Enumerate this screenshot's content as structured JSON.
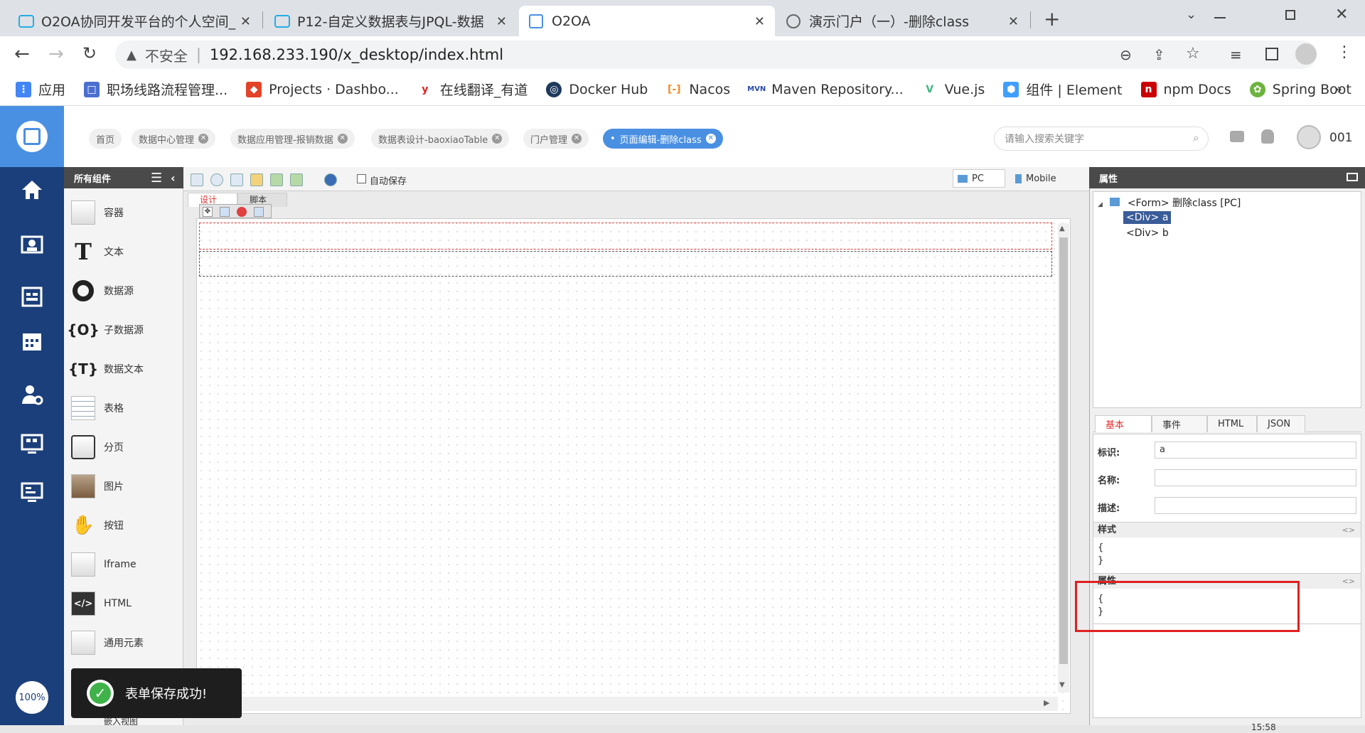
{
  "browser": {
    "tabs": [
      {
        "title": "O2OA协同开发平台的个人空间_"
      },
      {
        "title": "P12-自定义数据表与JPQL-数据"
      },
      {
        "title": "O2OA"
      },
      {
        "title": "演示门户（一）-删除class"
      }
    ],
    "new_tab_label": "+",
    "security_label": "不安全",
    "url": "192.168.233.190/x_desktop/index.html",
    "bookmarks": [
      {
        "label": "应用"
      },
      {
        "label": "职场线路流程管理..."
      },
      {
        "label": "Projects · Dashbo..."
      },
      {
        "label": "在线翻译_有道"
      },
      {
        "label": "Docker Hub"
      },
      {
        "label": "Nacos"
      },
      {
        "label": "Maven Repository..."
      },
      {
        "label": "Vue.js"
      },
      {
        "label": "组件 | Element"
      },
      {
        "label": "npm Docs"
      },
      {
        "label": "Spring Boot"
      }
    ],
    "more_label": "»"
  },
  "header": {
    "breadcrumbs": [
      {
        "label": "首页"
      },
      {
        "label": "数据中心管理"
      },
      {
        "label": "数据应用管理-报销数据"
      },
      {
        "label": "数据表设计-baoxiaoTable"
      },
      {
        "label": "门户管理"
      },
      {
        "label": "页面编辑-删除class"
      }
    ],
    "search_placeholder": "请输入搜索关键字",
    "user": "001"
  },
  "leftnav": {
    "zoom": "100%"
  },
  "components": {
    "title": "所有组件",
    "items": [
      {
        "label": "容器"
      },
      {
        "label": "文本"
      },
      {
        "label": "数据源"
      },
      {
        "label": "子数据源"
      },
      {
        "label": "数据文本"
      },
      {
        "label": "表格"
      },
      {
        "label": "分页"
      },
      {
        "label": "图片"
      },
      {
        "label": "按钮"
      },
      {
        "label": "Iframe"
      },
      {
        "label": "HTML"
      },
      {
        "label": "通用元素"
      }
    ],
    "partial_label": "嵌入视图"
  },
  "designer": {
    "autosave_label": "自动保存",
    "device_pc": "PC",
    "device_mobile": "Mobile",
    "tab_design": "设计",
    "tab_script": "脚本"
  },
  "properties": {
    "title": "属性",
    "tree_root": "<Form> 删除class [PC]",
    "tree_children": [
      {
        "label": "<Div> a"
      },
      {
        "label": "<Div> b"
      }
    ],
    "tabs": [
      {
        "label": "基本"
      },
      {
        "label": "事件"
      },
      {
        "label": "HTML"
      },
      {
        "label": "JSON"
      }
    ],
    "id_label": "标识:",
    "id_value": "a",
    "name_label": "名称:",
    "name_value": "",
    "desc_label": "描述:",
    "desc_value": "",
    "style_section": "样式",
    "style_code": "{\n}",
    "attr_section": "属性",
    "attr_code": "{\n}",
    "section_toggle": "<>"
  },
  "toast": {
    "message": "表单保存成功!"
  },
  "footer": {
    "time": "15:58"
  },
  "colors": {
    "accent": "#4a90e2",
    "nav": "#1b3f7a",
    "highlight": "#e02020"
  }
}
